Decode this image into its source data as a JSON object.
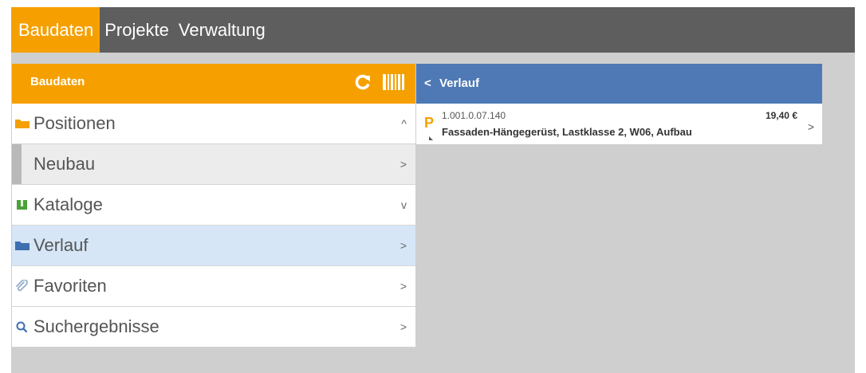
{
  "topnav": {
    "items": [
      {
        "label": "Baudaten",
        "active": true
      },
      {
        "label": "Projekte",
        "active": false
      },
      {
        "label": "Verwaltung",
        "active": false
      }
    ]
  },
  "left_panel": {
    "title": "Baudaten",
    "icons": [
      "refresh-icon",
      "barcode-icon"
    ],
    "tree": [
      {
        "label": "Positionen",
        "icon": "folder-icon",
        "icon_color": "#f5a000",
        "chevron": "^",
        "state": "expanded"
      },
      {
        "label": "Neubau",
        "chevron": ">",
        "state": "child"
      },
      {
        "label": "Kataloge",
        "icon": "book-icon",
        "icon_color": "#4aa23a",
        "chevron": "v",
        "state": "collapsed"
      },
      {
        "label": "Verlauf",
        "icon": "folder-icon",
        "icon_color": "#3e6fb0",
        "chevron": ">",
        "state": "selected"
      },
      {
        "label": "Favoriten",
        "icon": "paperclip-icon",
        "icon_color": "#8fa7c7",
        "chevron": ">",
        "state": "normal"
      },
      {
        "label": "Suchergebnisse",
        "icon": "search-icon",
        "icon_color": "#3e6fb0",
        "chevron": ">",
        "state": "normal"
      }
    ]
  },
  "right_panel": {
    "back_glyph": "<",
    "title": "Verlauf",
    "results": [
      {
        "tag": "P",
        "code": "1.001.0.07.140",
        "price": "19,40 €",
        "description": "Fassaden-Hängegerüst, Lastklasse 2, W06, Aufbau",
        "chevron": ">"
      }
    ]
  },
  "colors": {
    "accent": "#f5a000",
    "nav_bg": "#5e5e5e",
    "blue_header": "#4e79b5",
    "selected_row": "#d6e6f7",
    "background": "#cfcfcf"
  }
}
